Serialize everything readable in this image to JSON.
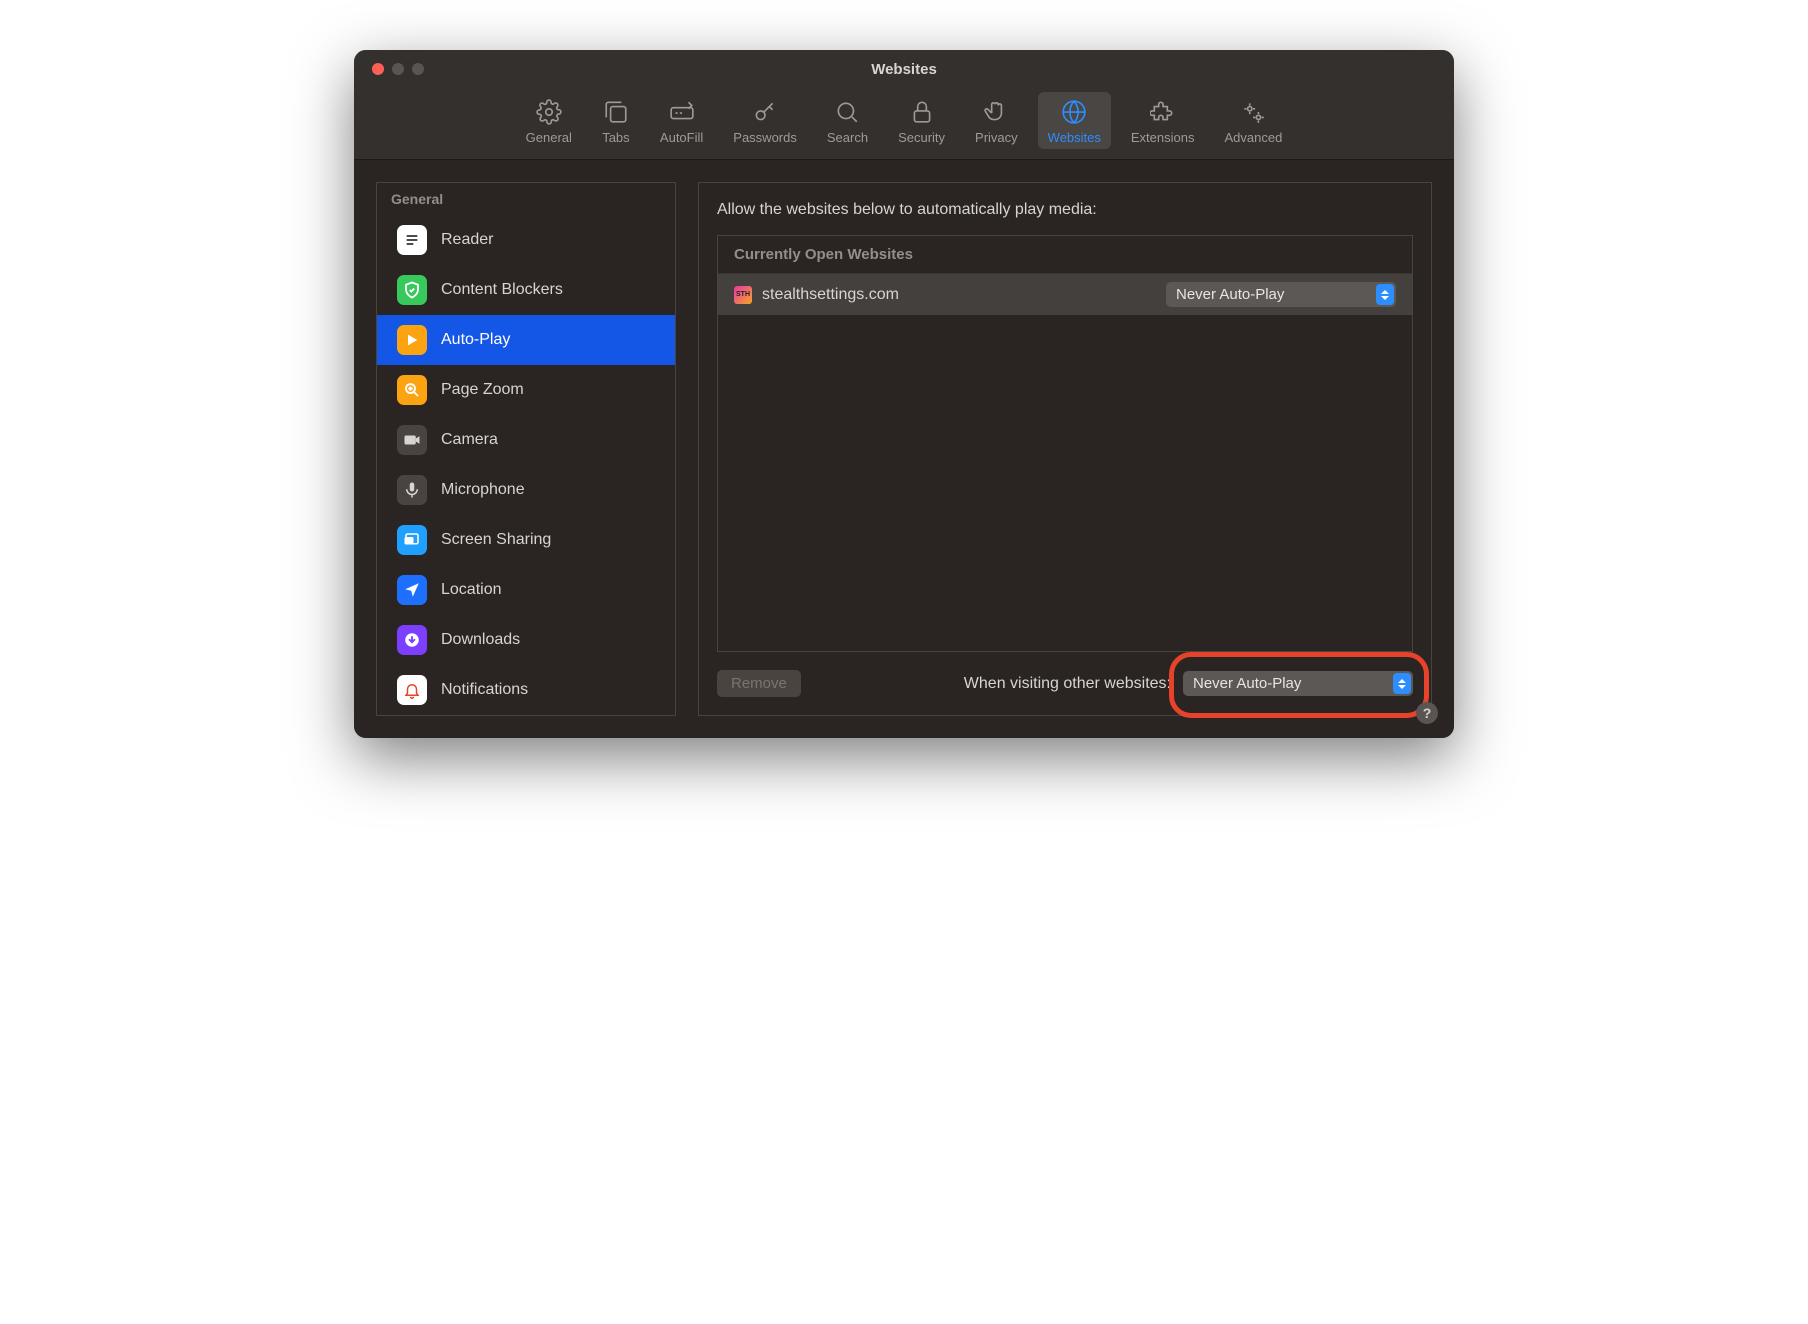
{
  "window": {
    "title": "Websites"
  },
  "toolbar": {
    "items": [
      {
        "label": "General"
      },
      {
        "label": "Tabs"
      },
      {
        "label": "AutoFill"
      },
      {
        "label": "Passwords"
      },
      {
        "label": "Search"
      },
      {
        "label": "Security"
      },
      {
        "label": "Privacy"
      },
      {
        "label": "Websites"
      },
      {
        "label": "Extensions"
      },
      {
        "label": "Advanced"
      }
    ]
  },
  "sidebar": {
    "header": "General",
    "items": [
      {
        "label": "Reader"
      },
      {
        "label": "Content Blockers"
      },
      {
        "label": "Auto-Play"
      },
      {
        "label": "Page Zoom"
      },
      {
        "label": "Camera"
      },
      {
        "label": "Microphone"
      },
      {
        "label": "Screen Sharing"
      },
      {
        "label": "Location"
      },
      {
        "label": "Downloads"
      },
      {
        "label": "Notifications"
      }
    ]
  },
  "main": {
    "heading": "Allow the websites below to automatically play media:",
    "list_header": "Currently Open Websites",
    "rows": [
      {
        "site": "stealthsettings.com",
        "favicon_text": "STH",
        "value": "Never Auto-Play"
      }
    ],
    "remove_label": "Remove",
    "bottom_label": "When visiting other websites:",
    "bottom_value": "Never Auto-Play"
  },
  "help": "?"
}
